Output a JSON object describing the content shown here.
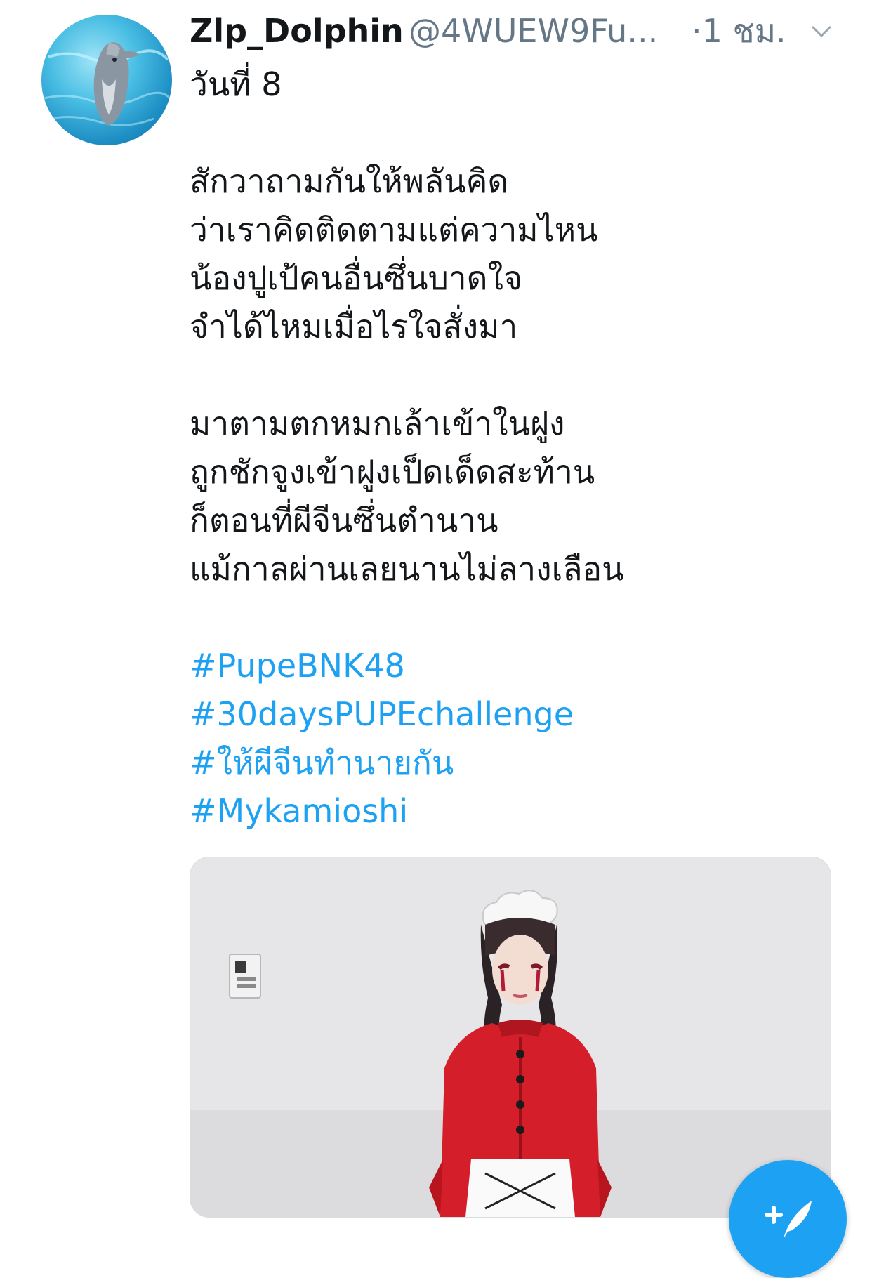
{
  "tweet": {
    "display_name": "Zlp_Dolphin",
    "handle": "@4WUEW9Fu...",
    "time": "·1 ชม.",
    "text_lines": [
      "วันที่ 8",
      "",
      "สักวาถามกันให้พลันคิด",
      "ว่าเราคิดติดตามแต่ความไหน",
      "น้องปูเป้คนอื่นซึ่นบาดใจ",
      "จำได้ไหมเมื่อไรใจสั่งมา",
      "",
      "มาตามตกหมกเล้าเข้าในฝูง",
      "ถูกชักจูงเข้าฝูงเป็ดเด็ดสะท้าน",
      "ก็ตอนที่ผีจีนซึ่นตำนาน",
      "แม้กาลผ่านเลยนานไม่ลางเลือน",
      ""
    ],
    "hashtags": [
      "#PupeBNK48",
      "#30daysPUPEchallenge",
      "#ให้ผีจีนทำนายกัน",
      "#Mykamioshi"
    ]
  },
  "colors": {
    "link": "#1da1f2",
    "muted": "#657786",
    "text": "#14171a",
    "fab": "#1da1f2"
  },
  "icons": {
    "menu": "chevron-down-icon",
    "compose": "feather-plus-icon"
  }
}
